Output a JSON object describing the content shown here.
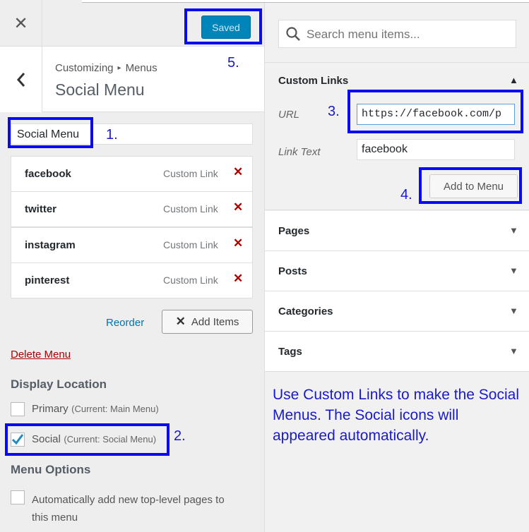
{
  "topbar": {
    "close_symbol": "✕",
    "saved_label": "Saved"
  },
  "header": {
    "breadcrumb_root": "Customizing",
    "breadcrumb_sep": "▸",
    "breadcrumb_section": "Menus",
    "title": "Social Menu",
    "back_icon": "chevron-left-icon"
  },
  "menu": {
    "name": "Social Menu",
    "items": [
      {
        "title": "facebook",
        "type": "Custom Link"
      },
      {
        "title": "twitter",
        "type": "Custom Link"
      },
      {
        "title": "instagram",
        "type": "Custom Link"
      },
      {
        "title": "pinterest",
        "type": "Custom Link"
      }
    ],
    "delete_symbol": "✕",
    "reorder_label": "Reorder",
    "add_items_label": "Add Items",
    "delete_menu_label": "Delete Menu"
  },
  "display_location": {
    "heading": "Display Location",
    "options": [
      {
        "label": "Primary",
        "note": "(Current: Main Menu)",
        "checked": false
      },
      {
        "label": "Social",
        "note": "(Current: Social Menu)",
        "checked": true
      }
    ]
  },
  "menu_options": {
    "heading": "Menu Options",
    "auto_add_label_line1": "Automatically add new top-level pages to",
    "auto_add_label_line2": "this menu",
    "auto_add_checked": false
  },
  "search": {
    "placeholder": "Search menu items..."
  },
  "custom_links": {
    "title": "Custom Links",
    "url_label": "URL",
    "url_value": "https://facebook.com/p",
    "link_text_label": "Link Text",
    "link_text_value": "facebook",
    "add_button_label": "Add to Menu"
  },
  "accordions": [
    {
      "title": "Pages"
    },
    {
      "title": "Posts"
    },
    {
      "title": "Categories"
    },
    {
      "title": "Tags"
    }
  ],
  "annotations": {
    "a1": "1.",
    "a2": "2.",
    "a3": "3.",
    "a4": "4.",
    "a5": "5.",
    "note": "Use Custom Links to make the Social Menus. The Social icons will appeared automatically."
  },
  "colors": {
    "accent": "#0085ba",
    "link": "#0073aa",
    "delete": "#aa0000",
    "annotation": "#0a0af0"
  }
}
